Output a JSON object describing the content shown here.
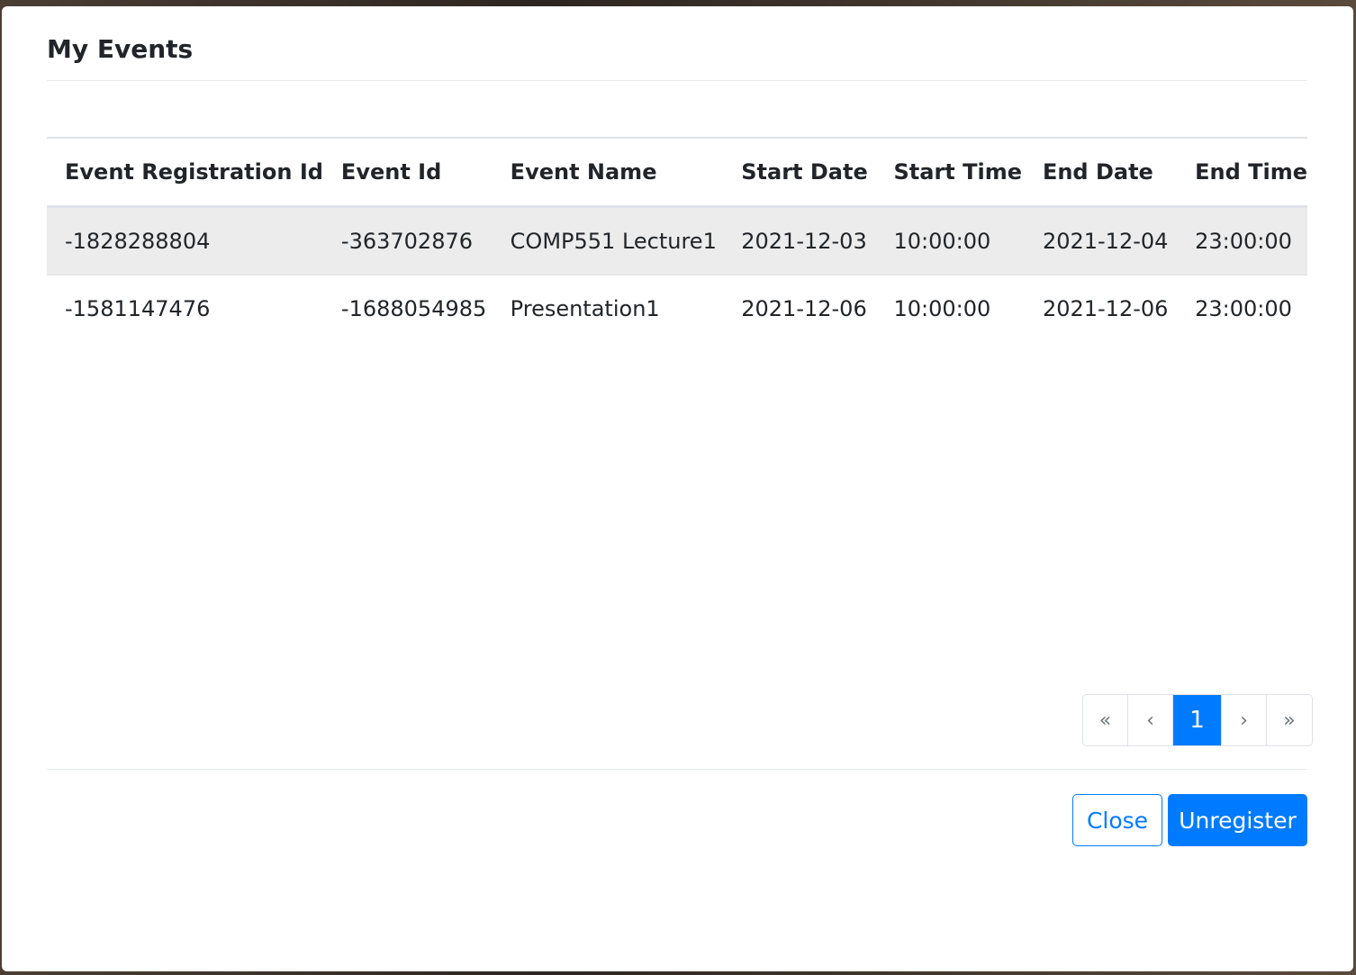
{
  "modal": {
    "title": "My Events"
  },
  "table": {
    "columns": [
      "Event Registration Id",
      "Event Id",
      "Event Name",
      "Start Date",
      "Start Time",
      "End Date",
      "End Time"
    ],
    "rows": [
      [
        "-1828288804",
        "-363702876",
        "COMP551 Lecture1",
        "2021-12-03",
        "10:00:00",
        "2021-12-04",
        "23:00:00"
      ],
      [
        "-1581147476",
        "-1688054985",
        "Presentation1",
        "2021-12-06",
        "10:00:00",
        "2021-12-06",
        "23:00:00"
      ]
    ]
  },
  "pagination": {
    "first": "«",
    "prev": "‹",
    "current": "1",
    "next": "›",
    "last": "»"
  },
  "footer": {
    "close_label": "Close",
    "unregister_label": "Unregister"
  },
  "colors": {
    "primary": "#007bff",
    "striped_row": "#ececec"
  }
}
